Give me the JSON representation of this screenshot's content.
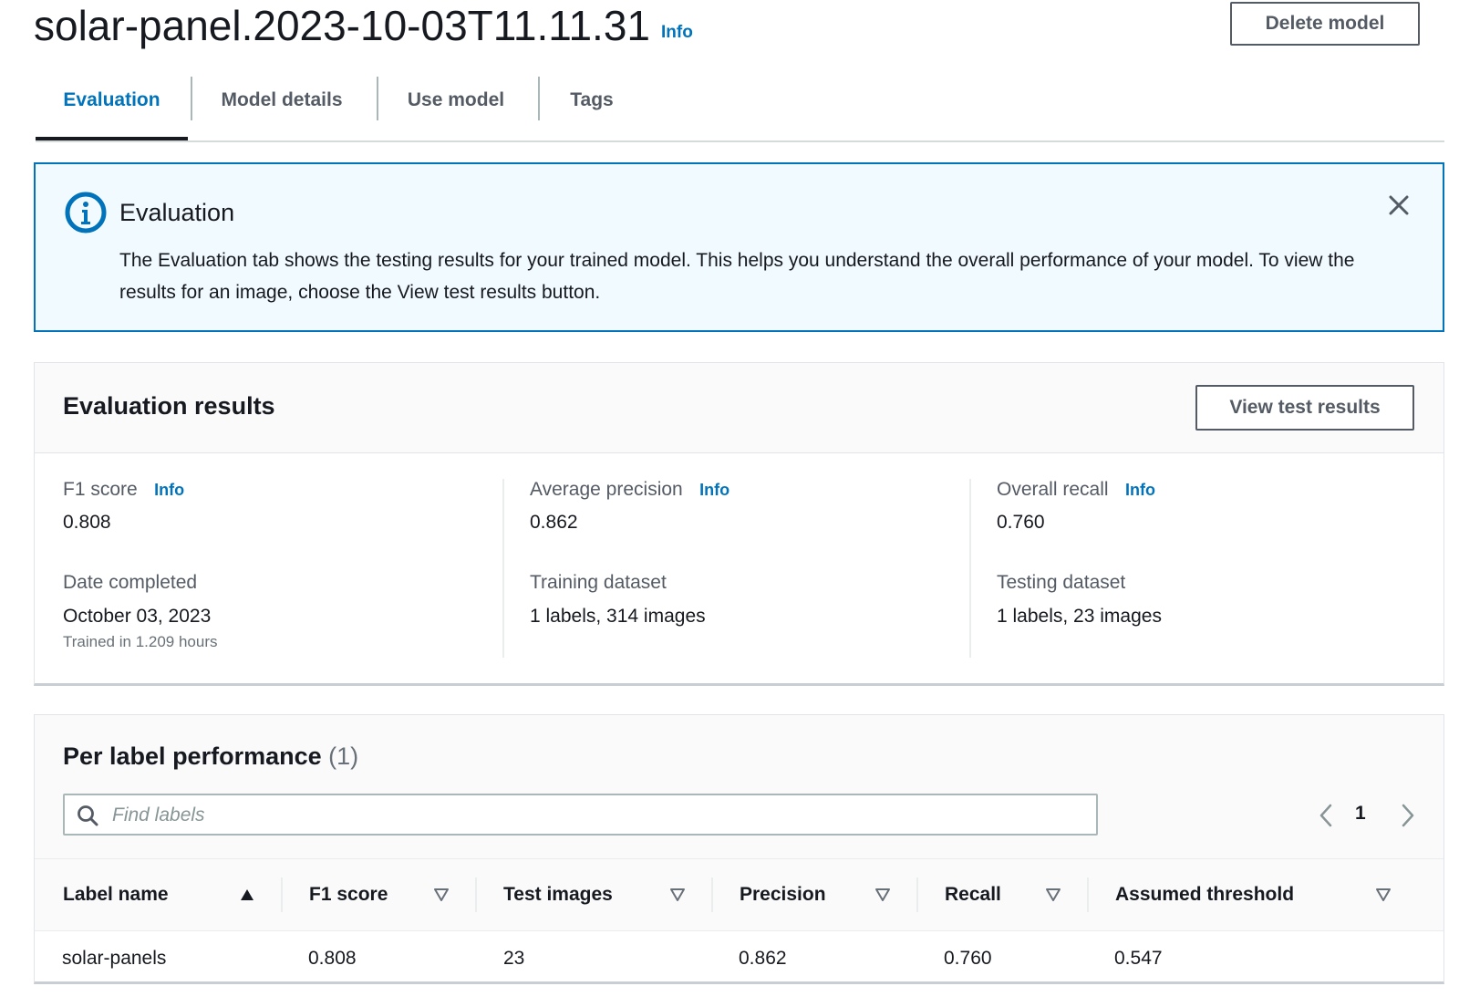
{
  "header": {
    "title": "solar-panel.2023-10-03T11.11.31",
    "info": "Info",
    "delete_button": "Delete model"
  },
  "tabs": [
    {
      "label": "Evaluation",
      "active": true
    },
    {
      "label": "Model details",
      "active": false
    },
    {
      "label": "Use model",
      "active": false
    },
    {
      "label": "Tags",
      "active": false
    }
  ],
  "alert": {
    "title": "Evaluation",
    "body": "The Evaluation tab shows the testing results for your trained model. This helps you understand the overall performance of your model. To view the results for an image, choose the View test results button.",
    "icon": "info-circle-icon",
    "close_icon": "close-icon"
  },
  "evaluation_results": {
    "title": "Evaluation results",
    "view_button": "View test results",
    "f1": {
      "label": "F1 score",
      "info": "Info",
      "value": "0.808"
    },
    "avg_precision": {
      "label": "Average precision",
      "info": "Info",
      "value": "0.862"
    },
    "overall_recall": {
      "label": "Overall recall",
      "info": "Info",
      "value": "0.760"
    },
    "date_completed": {
      "label": "Date completed",
      "value": "October 03, 2023",
      "sub": "Trained in 1.209 hours"
    },
    "training_dataset": {
      "label": "Training dataset",
      "value": "1 labels, 314 images"
    },
    "testing_dataset": {
      "label": "Testing dataset",
      "value": "1 labels, 23 images"
    }
  },
  "per_label": {
    "title": "Per label performance",
    "count": "(1)",
    "search_placeholder": "Find labels",
    "page": "1",
    "columns": [
      "Label name",
      "F1 score",
      "Test images",
      "Precision",
      "Recall",
      "Assumed threshold"
    ],
    "rows": [
      [
        "solar-panels",
        "0.808",
        "23",
        "0.862",
        "0.760",
        "0.547"
      ]
    ]
  },
  "colors": {
    "accent": "#0073bb",
    "alert_bg": "#f1faff",
    "text": "#16191f",
    "muted": "#545b64"
  }
}
